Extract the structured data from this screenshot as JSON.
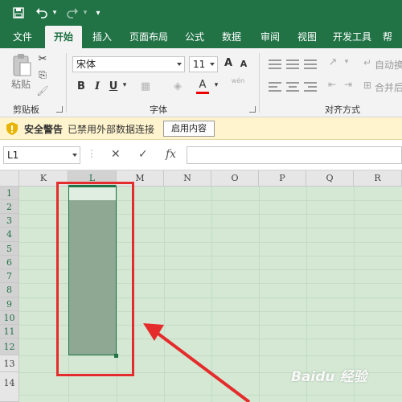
{
  "quick_access": {
    "save_icon": "save-icon",
    "undo_icon": "undo-icon",
    "redo_icon": "redo-icon",
    "customize_icon": "customize-icon"
  },
  "tabs": [
    "文件",
    "开始",
    "插入",
    "页面布局",
    "公式",
    "数据",
    "审阅",
    "视图",
    "开发工具",
    "帮"
  ],
  "active_tab": "开始",
  "ribbon": {
    "clipboard": {
      "paste": "粘贴",
      "label": "剪贴板"
    },
    "font": {
      "name": "宋体",
      "size": "11",
      "grow": "A",
      "shrink": "A",
      "bold": "B",
      "italic": "I",
      "underline": "U",
      "font_color": "A",
      "phonetic": "wén",
      "label": "字体"
    },
    "alignment": {
      "wrap": "自动换",
      "merge": "合并后",
      "label": "对齐方式"
    }
  },
  "security_bar": {
    "title": "安全警告",
    "message": "已禁用外部数据连接",
    "button": "启用内容"
  },
  "formula_bar": {
    "name_box": "L1",
    "cancel": "✕",
    "enter": "✓",
    "fx": "fx",
    "value": ""
  },
  "columns": [
    "K",
    "L",
    "M",
    "N",
    "O",
    "P",
    "Q",
    "R"
  ],
  "selected_column": "L",
  "rows": [
    "1",
    "2",
    "3",
    "4",
    "5",
    "6",
    "7",
    "8",
    "9",
    "10",
    "11",
    "12",
    "13",
    "14"
  ],
  "selection": {
    "range": "L1:L12",
    "active_cell": "L1"
  },
  "watermark": "Baidu 经验",
  "colors": {
    "accent": "#217346",
    "annotation": "#e52c2c",
    "security": "#fff4ce"
  }
}
